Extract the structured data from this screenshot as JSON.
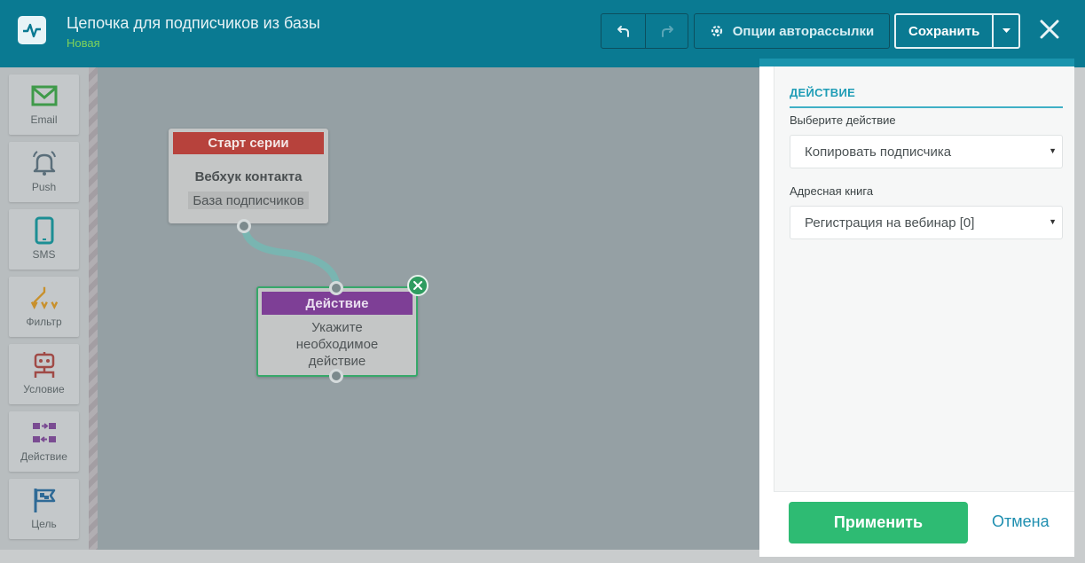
{
  "header": {
    "title": "Цепочка для подписчиков из базы",
    "subtitle": "Новая",
    "options_label": "Опции авторассылки",
    "save_label": "Сохранить",
    "icons": [
      "pulse-icon",
      "undo-icon",
      "redo-icon",
      "gear-icon",
      "caret-down-icon",
      "close-icon"
    ]
  },
  "sidebar": {
    "items": [
      {
        "label": "Email",
        "icon": "envelope-icon",
        "color": "#3f9a4a"
      },
      {
        "label": "Push",
        "icon": "bell-icon",
        "color": "#5a6e7a"
      },
      {
        "label": "SMS",
        "icon": "phone-icon",
        "color": "#1c8e94"
      },
      {
        "label": "Фильтр",
        "icon": "filter-icon",
        "color": "#c8902c"
      },
      {
        "label": "Условие",
        "icon": "condition-icon",
        "color": "#a04a46"
      },
      {
        "label": "Действие",
        "icon": "action-icon",
        "color": "#7a4c92"
      },
      {
        "label": "Цель",
        "icon": "flag-icon",
        "color": "#2f6a96"
      }
    ]
  },
  "canvas": {
    "start_node": {
      "header": "Старт серии",
      "title": "Вебхук контакта",
      "tag": "База подписчиков",
      "header_color": "#b7423c"
    },
    "action_node": {
      "header": "Действие",
      "description_lines": [
        "Укажите",
        "необходимое",
        "действие"
      ],
      "header_color": "#7e3f96"
    }
  },
  "panel": {
    "section_title": "ДЕЙСТВИЕ",
    "action_label": "Выберите действие",
    "action_value": "Копировать подписчика",
    "book_label": "Адресная книга",
    "book_value": "Регистрация на вебинар [0]",
    "apply_label": "Применить",
    "cancel_label": "Отмена",
    "accent": "#2ebb73"
  }
}
